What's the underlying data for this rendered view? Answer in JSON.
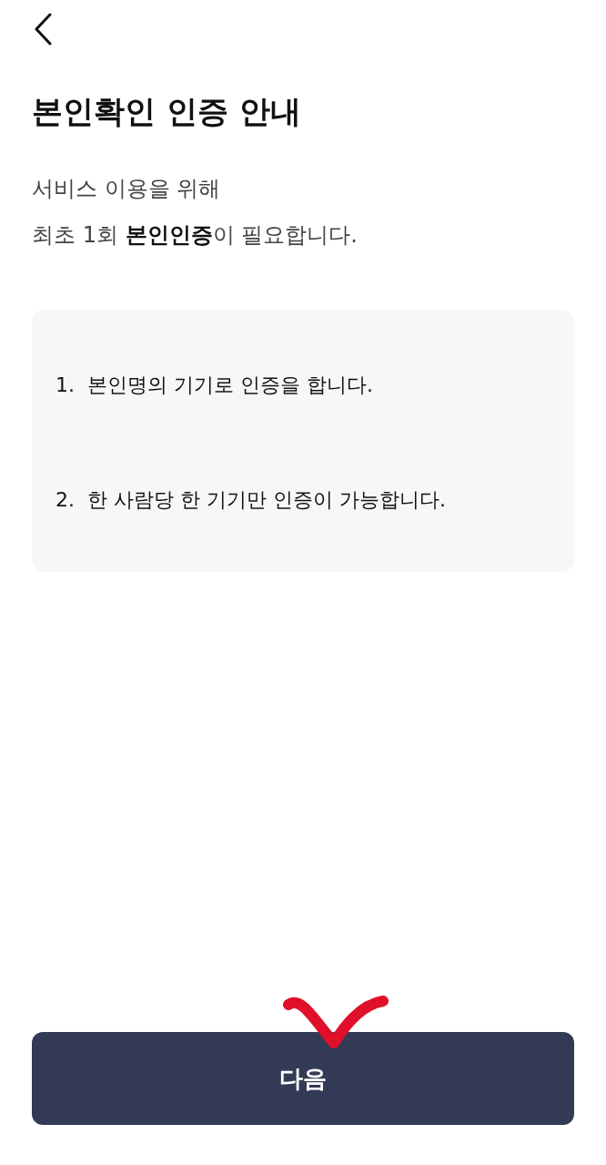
{
  "header": {
    "title": "본인확인 인증 안내"
  },
  "intro": [
    "서비스 이용을 위해",
    "최초 1회 **본인인증**이 필요합니다."
  ],
  "steps": [
    {
      "number": "1.",
      "text": "본인명의 기기로 인증을 합니다."
    },
    {
      "number": "2.",
      "text": "한 사람당 한 기기만 인증이 가능합니다."
    }
  ],
  "next_button": {
    "label": "다음"
  }
}
